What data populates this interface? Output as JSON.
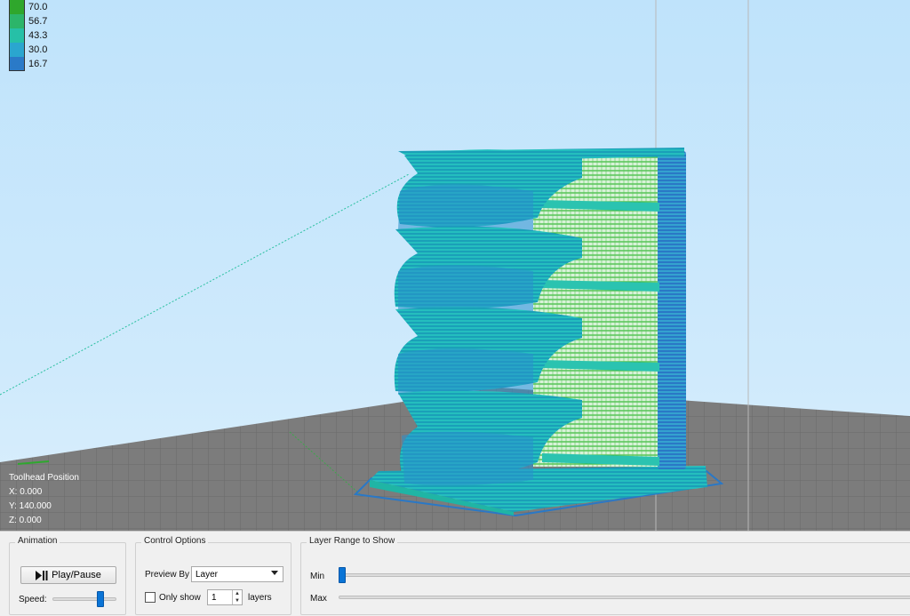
{
  "legend": {
    "items": [
      {
        "value": "70.0",
        "color": "#2fa72c"
      },
      {
        "value": "56.7",
        "color": "#2cb56a"
      },
      {
        "value": "43.3",
        "color": "#26c0a7"
      },
      {
        "value": "30.0",
        "color": "#2aa6cf"
      },
      {
        "value": "16.7",
        "color": "#2a7ac8"
      }
    ]
  },
  "toolhead": {
    "title": "Toolhead Position",
    "x": "X: 0.000",
    "y": "Y: 140.000",
    "z": "Z: 0.000"
  },
  "animation": {
    "title": "Animation",
    "play_pause_label": "Play/Pause",
    "play_pause_icon": "play-pause-icon",
    "speed_label": "Speed:"
  },
  "control_options": {
    "title": "Control Options",
    "preview_by_label": "Preview By",
    "preview_by_value": "Layer",
    "only_show_label": "Only show",
    "only_show_checked": false,
    "layers_count": "1",
    "layers_label": "layers"
  },
  "layer_range": {
    "title": "Layer Range to Show",
    "min_label": "Min",
    "max_label": "Max"
  },
  "colors": {
    "accent": "#0a74d6",
    "bed": "#7a7a7a",
    "sky": "#c6e6fb"
  }
}
